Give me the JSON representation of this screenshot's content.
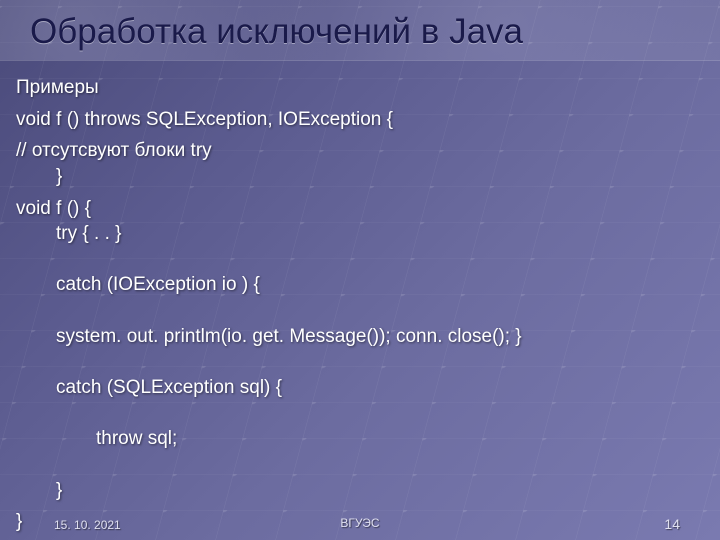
{
  "title": "Обработка исключений в Java",
  "subtitle": "Примеры",
  "code": {
    "line1": "void f () throws SQLException, IOException {",
    "line2": "// отсутсвуют блоки try",
    "line3": "}",
    "line4": "void f () {",
    "line5": "try { . . }",
    "line6": "catch (IOException io ) {",
    "line7": "system. out. printlm(io. get. Message()); conn. close(); }",
    "line8": "catch (SQLException sql) {",
    "line9": "throw sql;",
    "line10": "}",
    "line11": "}"
  },
  "footer": {
    "date": "15. 10. 2021",
    "org": "ВГУЭС",
    "page": "14"
  }
}
